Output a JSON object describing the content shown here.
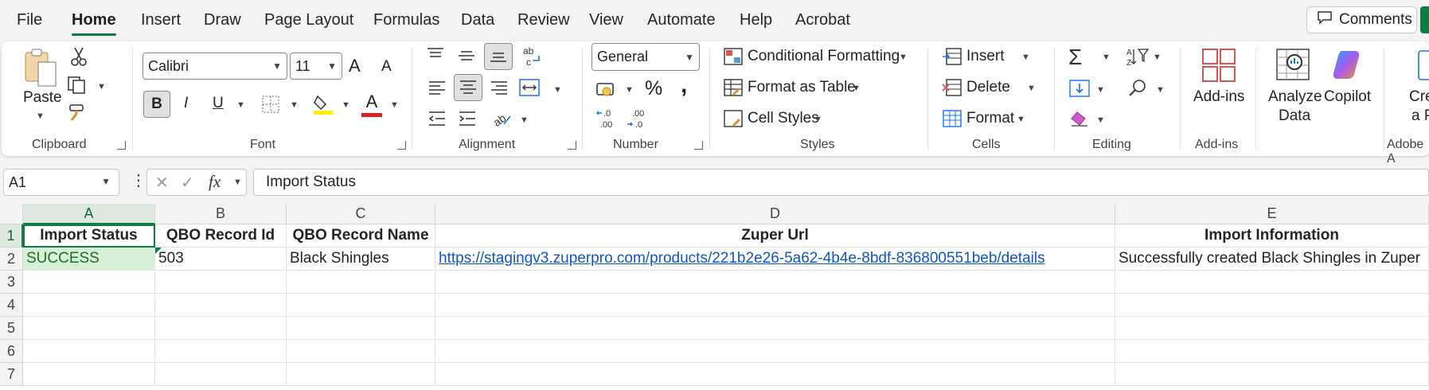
{
  "menu": {
    "tabs": [
      "File",
      "Home",
      "Insert",
      "Draw",
      "Page Layout",
      "Formulas",
      "Data",
      "Review",
      "View",
      "Automate",
      "Help",
      "Acrobat"
    ],
    "active": "Home",
    "comments_label": "Comments"
  },
  "ribbon": {
    "clipboard": {
      "paste_label": "Paste",
      "group_label": "Clipboard"
    },
    "font": {
      "font_name": "Calibri",
      "font_size": "11",
      "group_label": "Font",
      "bold": "B",
      "italic": "I",
      "underline": "U",
      "grow": "A",
      "shrink": "A",
      "font_color_glyph": "A"
    },
    "alignment": {
      "group_label": "Alignment"
    },
    "number": {
      "format": "General",
      "percent": "%",
      "comma": ",",
      "group_label": "Number",
      "inc_decimal": ".0\n.00",
      "dec_decimal": ".00\n.0"
    },
    "styles": {
      "conditional_formatting": "Conditional Formatting",
      "format_as_table": "Format as Table",
      "cell_styles": "Cell Styles",
      "group_label": "Styles"
    },
    "cells": {
      "insert": "Insert",
      "delete": "Delete",
      "format": "Format",
      "group_label": "Cells"
    },
    "editing": {
      "group_label": "Editing"
    },
    "addins": {
      "label": "Add-ins",
      "group_label": "Add-ins"
    },
    "analyze": {
      "line1": "Analyze",
      "line2": "Data"
    },
    "copilot": {
      "label": "Copilot"
    },
    "acrobat": {
      "line1": "Cre",
      "line2": "a P",
      "group_label": "Adobe A"
    }
  },
  "formula_bar": {
    "name_box": "A1",
    "formula": "Import Status",
    "fx": "fx"
  },
  "sheet": {
    "columns": [
      "A",
      "B",
      "C",
      "D",
      "E"
    ],
    "rows": [
      "1",
      "2",
      "3",
      "4",
      "5",
      "6",
      "7"
    ],
    "header_row": [
      "Import Status",
      "QBO Record Id",
      "QBO Record Name",
      "Zuper Url",
      "Import Information"
    ],
    "data_row": [
      "SUCCESS",
      "503",
      "Black Shingles",
      "https://stagingv3.zuperpro.com/products/221b2e26-5a62-4b4e-8bdf-836800551beb/details",
      "Successfully created Black Shingles in Zuper"
    ]
  },
  "colors": {
    "accent": "#107c41",
    "success_fill": "#d8f0d6",
    "link": "#1155cc"
  }
}
